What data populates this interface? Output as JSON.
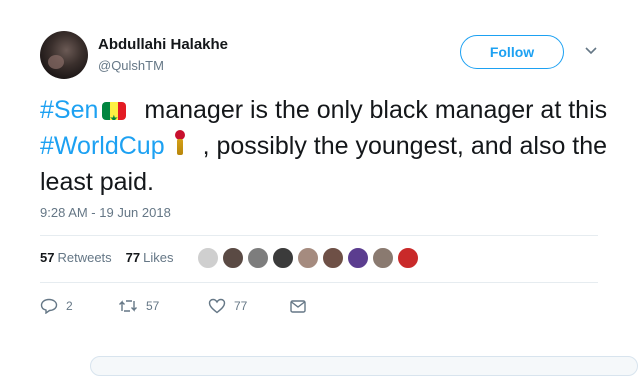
{
  "author": {
    "name": "Abdullahi Halakhe",
    "handle": "@QulshTM",
    "follow_label": "Follow"
  },
  "tweet": {
    "hashtag1": "#Sen",
    "segment1": "manager is the only black manager at this",
    "hashtag2": "#WorldCup",
    "segment2": ", possibly the youngest, and also the least paid."
  },
  "timestamp": "9:28 AM - 19 Jun 2018",
  "stats": {
    "retweets_count": "57",
    "retweets_label": "Retweets",
    "likes_count": "77",
    "likes_label": "Likes"
  },
  "liker_avatar_colors": [
    "#cfcfcf",
    "#5a4a44",
    "#7d7d7d",
    "#3b3b3b",
    "#a58b7f",
    "#6e5046",
    "#5b3d8f",
    "#8a7a70",
    "#c92a2a"
  ],
  "actions": {
    "reply_count": "2",
    "retweet_count": "57",
    "like_count": "77"
  },
  "colors": {
    "accent": "#1da1f2",
    "text": "#14171a",
    "muted": "#657786"
  }
}
